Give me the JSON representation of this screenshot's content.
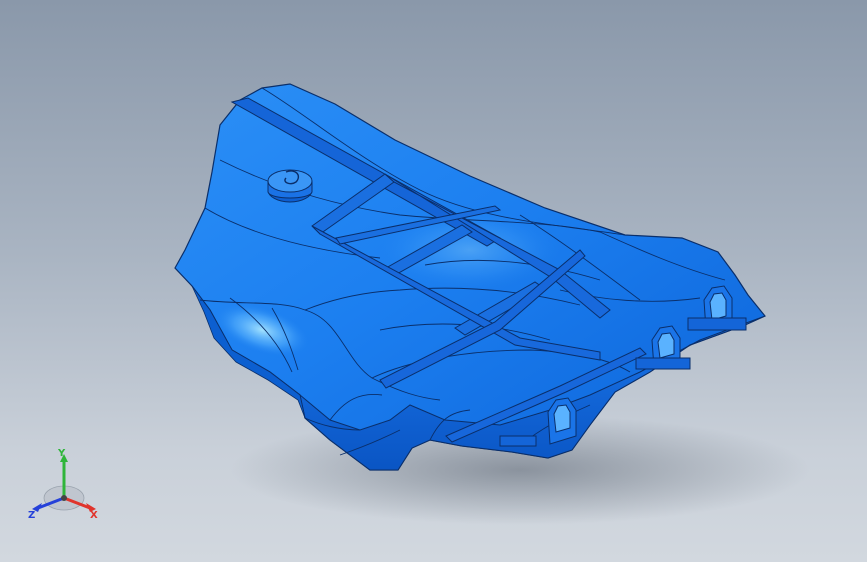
{
  "viewport": {
    "background_top": "#8a98aa",
    "background_bottom": "#d2d8df"
  },
  "model": {
    "name": "",
    "color": "#1c7ff0",
    "color_dark": "#0b5fd6",
    "highlight": "#7fd0ff",
    "edge_color": "#0a2f6b"
  },
  "triad": {
    "x_label": "X",
    "y_label": "Y",
    "z_label": "Z",
    "x_color": "#e0342c",
    "y_color": "#2fb53a",
    "z_color": "#2541d9"
  }
}
